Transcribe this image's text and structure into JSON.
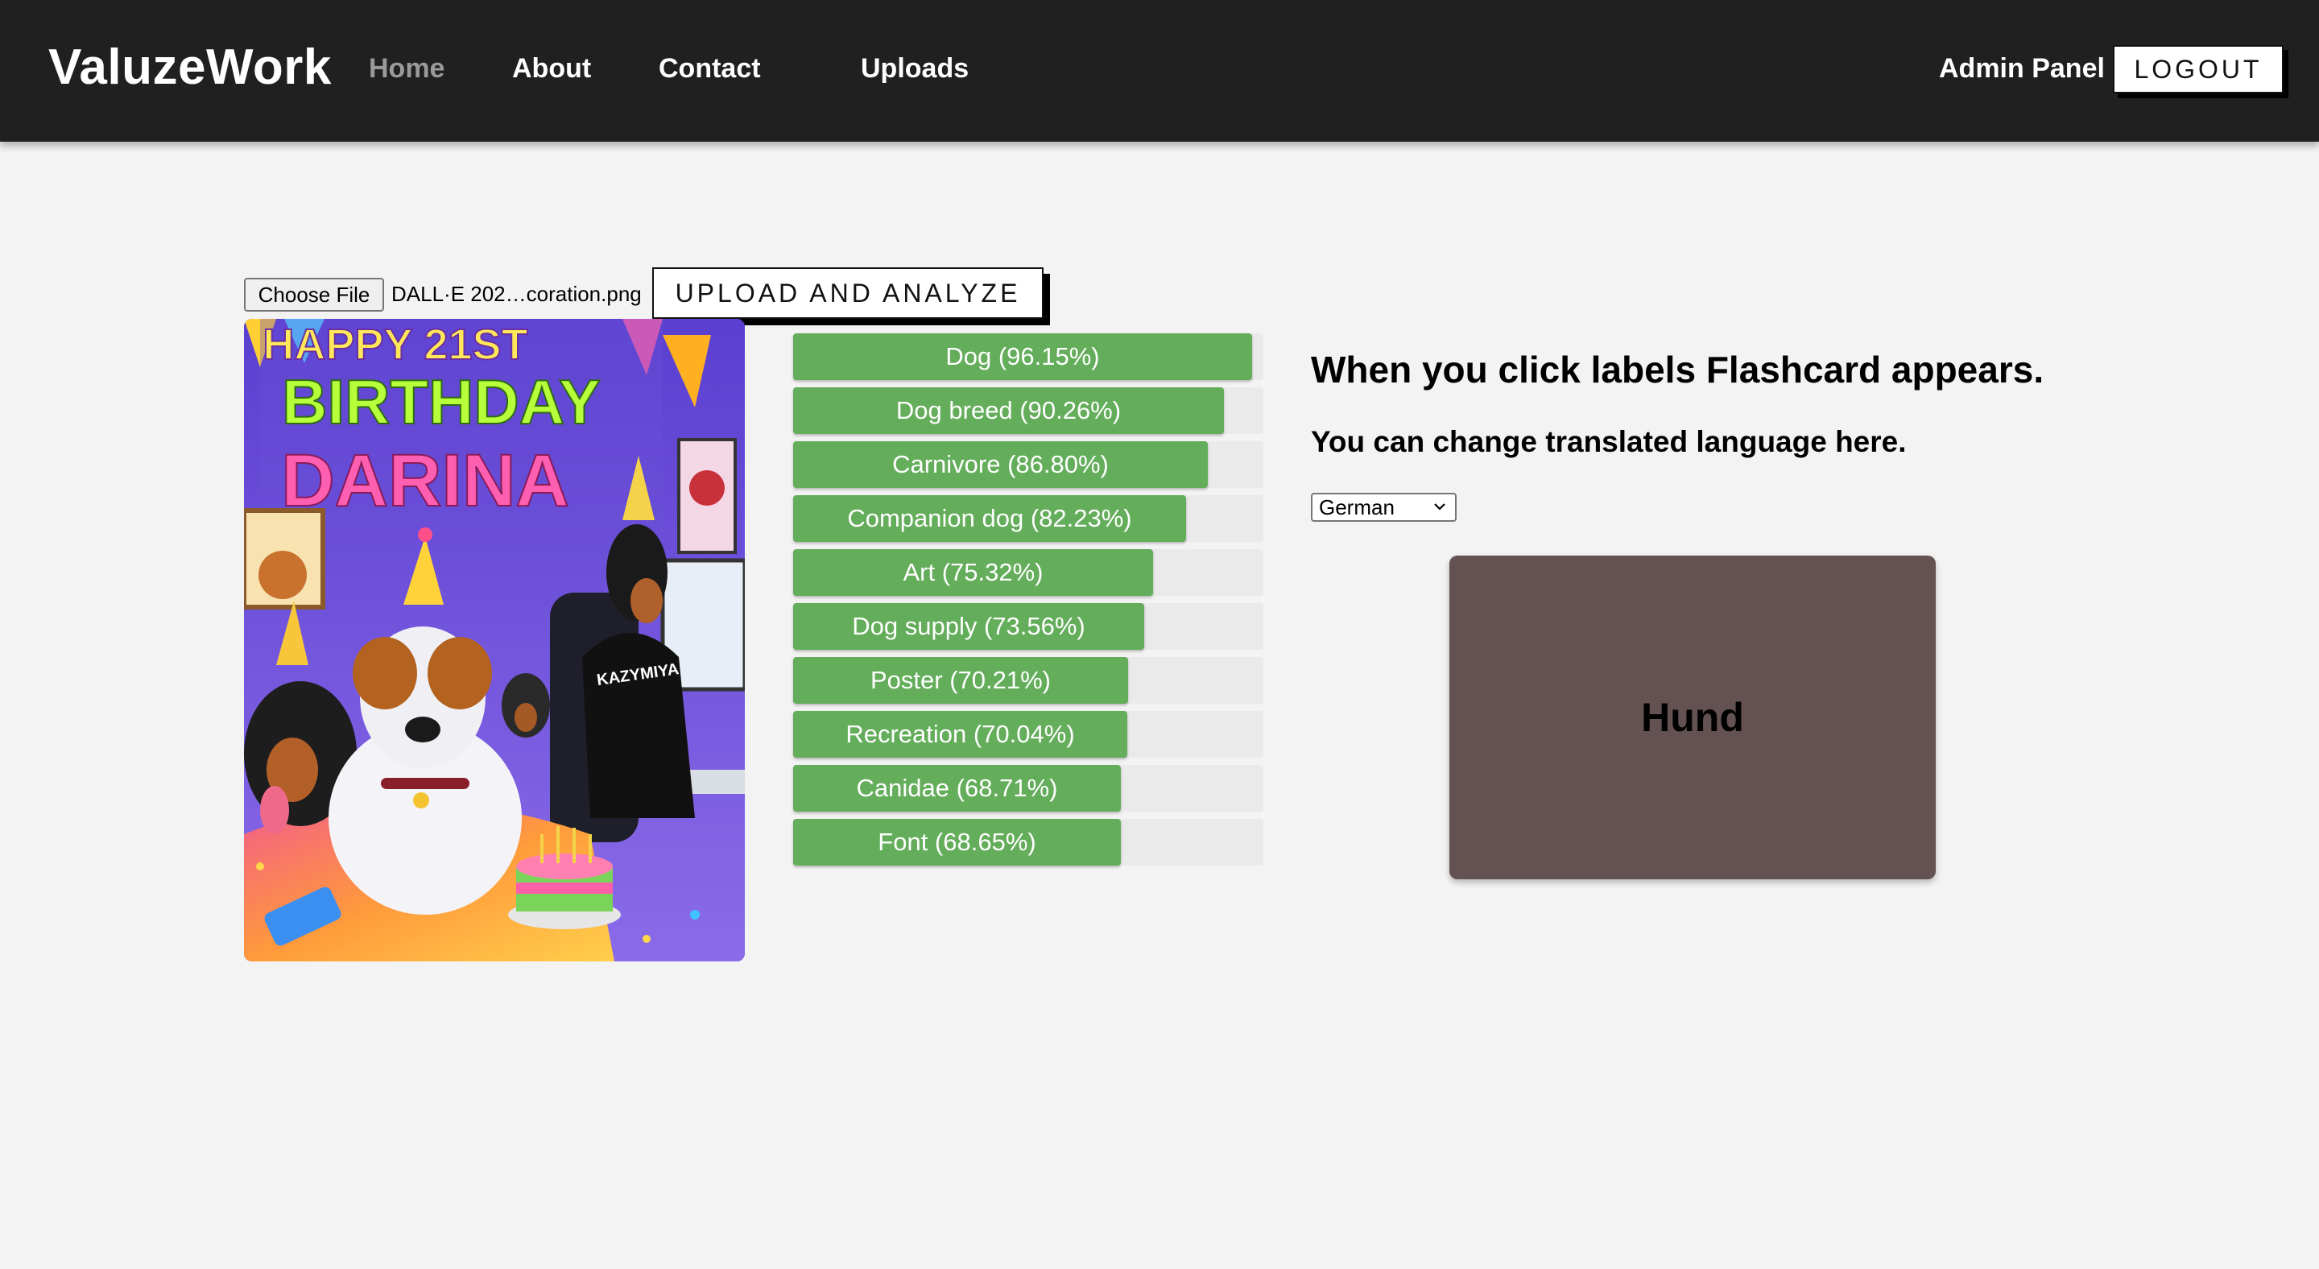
{
  "header": {
    "brand": "ValuzeWork",
    "nav": [
      {
        "label": "Home",
        "active": true
      },
      {
        "label": "About"
      },
      {
        "label": "Contact"
      },
      {
        "label": "Uploads"
      },
      {
        "label": "Admin Panel"
      }
    ],
    "logout_label": "LOGOUT"
  },
  "upload": {
    "choose_file_label": "Choose File",
    "file_name": "DALL·E 202…coration.png",
    "upload_button_label": "UPLOAD AND ANALYZE"
  },
  "preview_image": {
    "texts": [
      "HAPPY 21ST",
      "BIRTHDAY",
      "DARINA",
      "KAZYMIYA"
    ]
  },
  "labels": [
    {
      "text": "Dog (96.15%)",
      "score": 96.15
    },
    {
      "text": "Dog breed (90.26%)",
      "score": 90.26
    },
    {
      "text": "Carnivore (86.80%)",
      "score": 86.8
    },
    {
      "text": "Companion dog (82.23%)",
      "score": 82.23
    },
    {
      "text": "Art (75.32%)",
      "score": 75.32
    },
    {
      "text": "Dog supply (73.56%)",
      "score": 73.56
    },
    {
      "text": "Poster (70.21%)",
      "score": 70.21
    },
    {
      "text": "Recreation (70.04%)",
      "score": 70.04
    },
    {
      "text": "Canidae (68.71%)",
      "score": 68.71
    },
    {
      "text": "Font (68.65%)",
      "score": 68.65
    }
  ],
  "panel": {
    "instructions": "When you click labels Flashcard appears.",
    "language_hint": "You can change translated language here.",
    "language_selected": "German",
    "flashcard_word": "Hund"
  },
  "colors": {
    "navbar": "#202020",
    "label_fill": "#64ad5b",
    "flashcard": "#645252",
    "background": "#f3f3f3"
  }
}
